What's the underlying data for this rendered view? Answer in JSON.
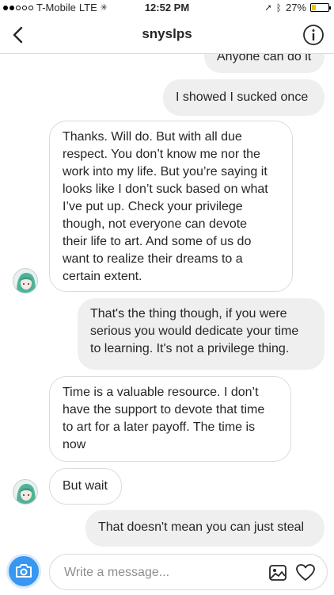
{
  "status_bar": {
    "carrier": "T-Mobile",
    "network": "LTE",
    "time": "12:52 PM",
    "battery": "27%",
    "battery_level": 0.27
  },
  "header": {
    "title": "snyslps"
  },
  "messages": [
    {
      "from": "me",
      "text": "Anyone can do it"
    },
    {
      "from": "me",
      "text": "I showed I sucked once"
    },
    {
      "from": "them",
      "lines": [
        "Thanks. Will do. But with all due",
        "respect. You don’t know me nor the",
        "work into my life. But you’re saying it",
        "looks like I don’t suck based on what",
        "I’ve put up. Check your privilege",
        "though, not everyone can devote",
        "their life to art. And some of us do",
        "want to realize their dreams to a",
        "certain extent."
      ]
    },
    {
      "from": "me",
      "lines": [
        "That's the thing though, if you were",
        "serious you would dedicate your time",
        "to learning. It's not a privilege thing."
      ]
    },
    {
      "from": "them",
      "lines": [
        "Time is a valuable resource. I don’t",
        "have the support to devote that time",
        "to art for a later payoff. The time is",
        "now"
      ]
    },
    {
      "from": "them",
      "text": "But wait"
    },
    {
      "from": "me",
      "text": "That doesn't mean you can just steal"
    }
  ],
  "composer": {
    "placeholder": "Write a message..."
  },
  "icons": {
    "back": "chevron-left-icon",
    "info": "info-icon",
    "camera": "camera-icon",
    "gallery": "gallery-icon",
    "heart": "heart-icon"
  },
  "colors": {
    "accent": "#3897f0",
    "outgoing_bubble": "#efefef",
    "incoming_border": "#dbdbdb"
  }
}
